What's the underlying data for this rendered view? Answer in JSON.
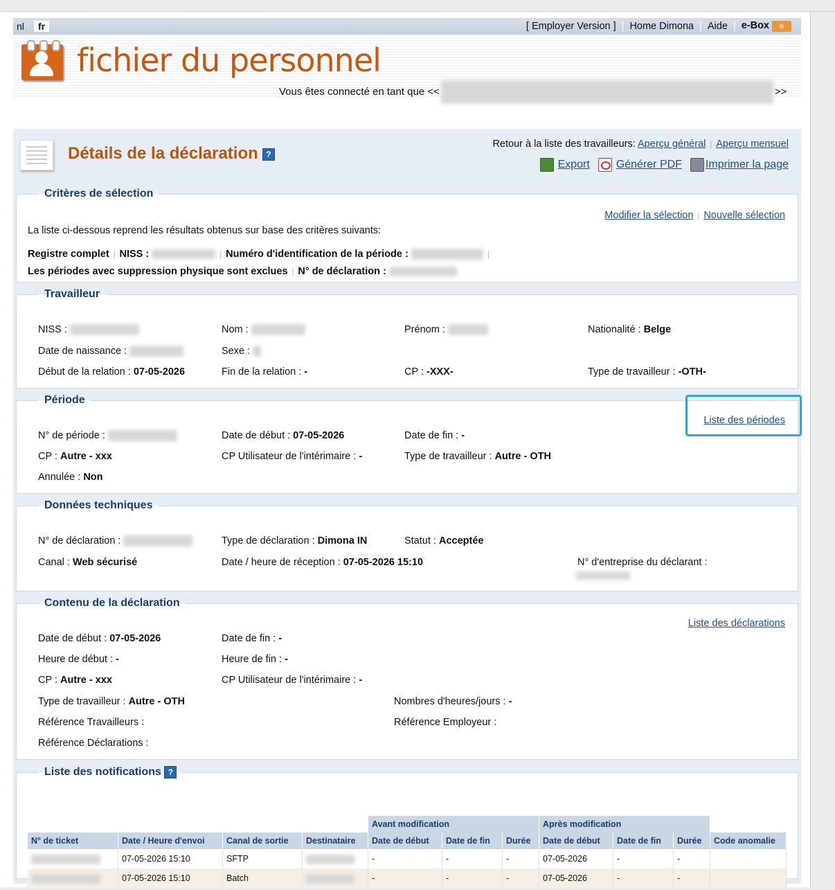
{
  "header": {
    "lang_nl": "nl",
    "lang_fr": "fr",
    "employer_version": "[ Employer Version ]",
    "home_dimona": "Home Dimona",
    "aide": "Aide",
    "ebox": "e-Box"
  },
  "banner": {
    "app_title": "fichier du personnel",
    "connected_prefix": "Vous êtes connecté en tant que <<",
    "connected_suffix": ">>"
  },
  "page": {
    "title": "Détails de la déclaration",
    "retour_label": "Retour à la liste des travailleurs:",
    "apercu_general": "Aperçu général",
    "apercu_mensuel": "Aperçu mensuel",
    "export": "Export",
    "generer_pdf": "Générer PDF",
    "imprimer": "Imprimer la page"
  },
  "criteres": {
    "legend": "Critères de sélection",
    "modifier": "Modifier la sélection",
    "nouvelle": "Nouvelle sélection",
    "intro": "La liste ci-dessous reprend les résultats obtenus sur base des critères suivants:",
    "registre": "Registre complet",
    "niss_label": "NISS :",
    "periode_id_label": "Numéro d'identification de la période :",
    "suppression": "Les périodes avec suppression physique sont exclues",
    "declaration_label": "N° de déclaration :"
  },
  "travailleur": {
    "legend": "Travailleur",
    "niss": "NISS :",
    "nom": "Nom :",
    "prenom": "Prénom :",
    "nationalite_label": "Nationalité :",
    "nationalite_value": "Belge",
    "naissance": "Date de naissance :",
    "sexe": "Sexe :",
    "debut_label": "Début de la relation :",
    "debut_value": "07-05-2026",
    "fin_label": "Fin de la relation :",
    "fin_value": "-",
    "cp_label": "CP :",
    "cp_value": "-XXX-",
    "type_label": "Type de travailleur :",
    "type_value": "-OTH-"
  },
  "periode": {
    "legend": "Période",
    "liste_link": "Liste des périodes",
    "num_label": "N° de période :",
    "debut_label": "Date de début :",
    "debut_value": "07-05-2026",
    "fin_label": "Date de fin :",
    "fin_value": "-",
    "cp_label": "CP :",
    "cp_value": "Autre - xxx",
    "cp_util_label": "CP Utilisateur de l'intérimaire :",
    "cp_util_value": "-",
    "type_label": "Type de travailleur :",
    "type_value": "Autre - OTH",
    "annulee_label": "Annulée :",
    "annulee_value": "Non"
  },
  "technique": {
    "legend": "Données techniques",
    "decl_label": "N° de déclaration :",
    "type_label": "Type de déclaration :",
    "type_value": "Dimona IN",
    "statut_label": "Statut :",
    "statut_value": "Acceptée",
    "canal_label": "Canal :",
    "canal_value": "Web sécurisé",
    "reception_label": "Date / heure de réception :",
    "reception_value": "07-05-2026 15:10",
    "entreprise_label": "N° d'entreprise du déclarant :"
  },
  "contenu": {
    "legend": "Contenu de la déclaration",
    "liste_link": "Liste des déclarations",
    "debut_label": "Date de début :",
    "debut_value": "07-05-2026",
    "fin_label": "Date de fin :",
    "fin_value": "-",
    "heure_debut_label": "Heure de début :",
    "heure_debut_value": "-",
    "heure_fin_label": "Heure de fin :",
    "heure_fin_value": "-",
    "cp_label": "CP :",
    "cp_value": "Autre - xxx",
    "cp_util_label": "CP Utilisateur de l'intérimaire :",
    "cp_util_value": "-",
    "type_label": "Type de travailleur :",
    "type_value": "Autre - OTH",
    "heures_label": "Nombres d'heures/jours :",
    "heures_value": "-",
    "ref_trav": "Référence  Travailleurs :",
    "ref_empl": "Référence  Employeur :",
    "ref_decl": "Référence  Déclarations :"
  },
  "notifications": {
    "legend": "Liste des notifications",
    "group_avant": "Avant modification",
    "group_apres": "Après modification",
    "columns": [
      "N° de ticket",
      "Date / Heure d'envoi",
      "Canal de sortie",
      "Destinataire",
      "Date de début",
      "Date de fin",
      "Durée",
      "Date de début",
      "Date de fin",
      "Durée",
      "Code anomalie"
    ],
    "rows": [
      {
        "date": "07-05-2026 15:10",
        "canal": "SFTP",
        "av_debut": "-",
        "av_fin": "-",
        "av_duree": "-",
        "ap_debut": "07-05-2026",
        "ap_fin": "-",
        "ap_duree": "-",
        "anomalie": ""
      },
      {
        "date": "07-05-2026 15:10",
        "canal": "Batch",
        "av_debut": "-",
        "av_fin": "-",
        "av_duree": "-",
        "ap_debut": "07-05-2026",
        "ap_fin": "-",
        "ap_duree": "-",
        "anomalie": ""
      }
    ]
  }
}
